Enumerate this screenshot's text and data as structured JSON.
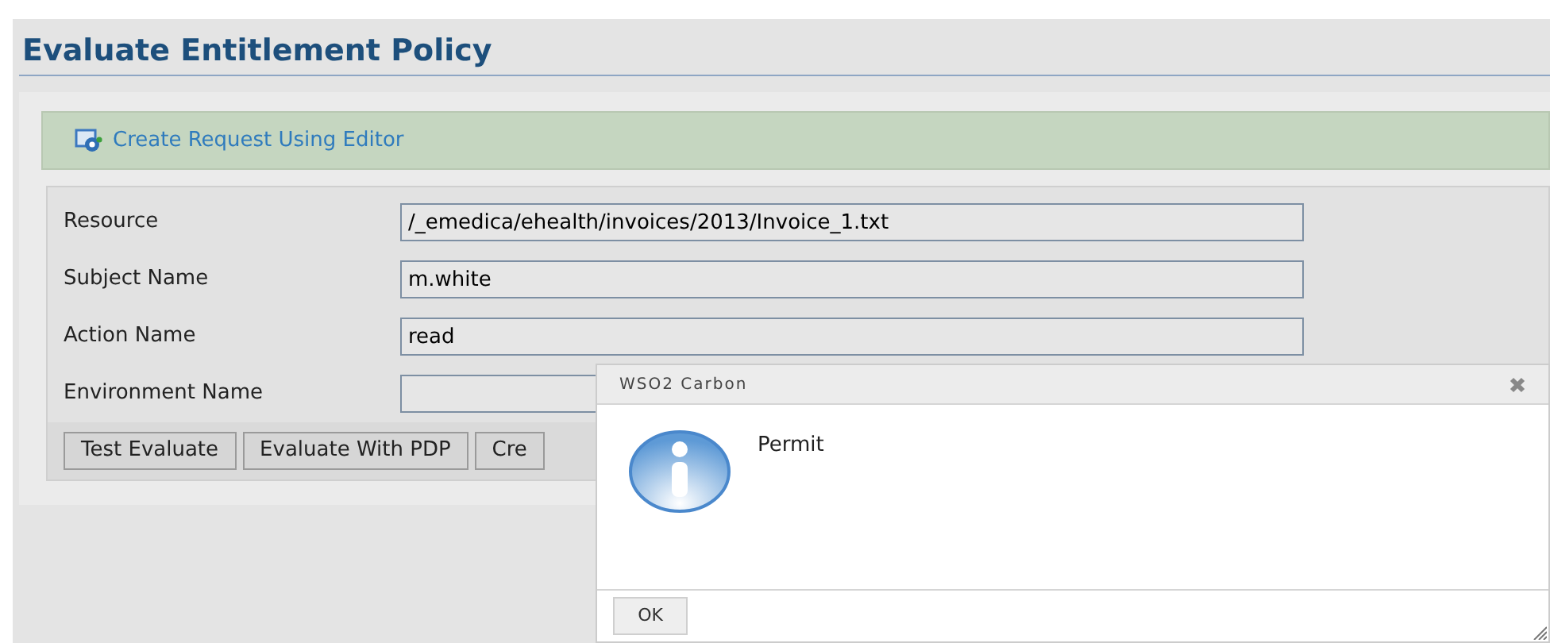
{
  "page_title": "Evaluate Entitlement Policy",
  "editor_link": "Create Request Using Editor",
  "fields": [
    {
      "label": "Resource",
      "value": "/_emedica/ehealth/invoices/2013/Invoice_1.txt"
    },
    {
      "label": "Subject Name",
      "value": "m.white"
    },
    {
      "label": "Action Name",
      "value": "read"
    },
    {
      "label": "Environment Name"
    }
  ],
  "buttons": [
    "Test Evaluate",
    "Evaluate With PDP",
    "Cre"
  ],
  "dialog": {
    "title": "WSO2 Carbon",
    "message": "Permit",
    "ok_button": "OK"
  }
}
